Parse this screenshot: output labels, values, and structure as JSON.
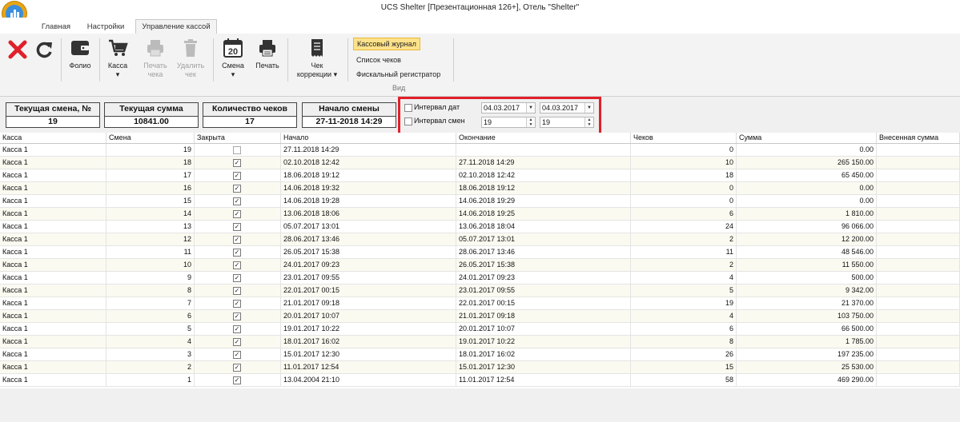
{
  "window": {
    "title": "UCS Shelter [Презентационная 126+], Отель \"Shelter\""
  },
  "tabs": [
    {
      "label": "Главная",
      "active": false
    },
    {
      "label": "Настройки",
      "active": false
    },
    {
      "label": "Управление кассой",
      "active": true
    }
  ],
  "ribbon": {
    "folio": "Фолио",
    "kassa": "Касса",
    "print_check": "Печать\nчека",
    "delete_check": "Удалить\nчек",
    "calendar_day": "20",
    "shift": "Смена",
    "print": "Печать",
    "correction": "Чек\nкоррекции",
    "view_items": [
      "Кассовый журнал",
      "Список чеков",
      "Фискальный регистратор"
    ],
    "view_group_label": "Вид"
  },
  "info": {
    "shift_title": "Текущая смена, №",
    "shift_value": "19",
    "sum_title": "Текущая сумма",
    "sum_value": "10841.00",
    "count_title": "Количество чеков",
    "count_value": "17",
    "start_title": "Начало смены",
    "start_value": "27-11-2018 14:29"
  },
  "filter": {
    "date_label": "Интервал дат",
    "shift_label": "Интервал смен",
    "date_from": "04.03.2017",
    "date_to": "04.03.2017",
    "shift_from": "19",
    "shift_to": "19"
  },
  "table": {
    "columns": [
      "Касса",
      "Смена",
      "Закрыта",
      "Начало",
      "Окончание",
      "Чеков",
      "Сумма",
      "Внесенная сумма"
    ],
    "rows": [
      {
        "kassa": "Касса 1",
        "shift": "19",
        "closed": false,
        "start": "27.11.2018 14:29",
        "end": "",
        "checks": "0",
        "sum": "0.00"
      },
      {
        "kassa": "Касса 1",
        "shift": "18",
        "closed": true,
        "start": "02.10.2018 12:42",
        "end": "27.11.2018 14:29",
        "checks": "10",
        "sum": "265 150.00"
      },
      {
        "kassa": "Касса 1",
        "shift": "17",
        "closed": true,
        "start": "18.06.2018 19:12",
        "end": "02.10.2018 12:42",
        "checks": "18",
        "sum": "65 450.00"
      },
      {
        "kassa": "Касса 1",
        "shift": "16",
        "closed": true,
        "start": "14.06.2018 19:32",
        "end": "18.06.2018 19:12",
        "checks": "0",
        "sum": "0.00"
      },
      {
        "kassa": "Касса 1",
        "shift": "15",
        "closed": true,
        "start": "14.06.2018 19:28",
        "end": "14.06.2018 19:29",
        "checks": "0",
        "sum": "0.00"
      },
      {
        "kassa": "Касса 1",
        "shift": "14",
        "closed": true,
        "start": "13.06.2018 18:06",
        "end": "14.06.2018 19:25",
        "checks": "6",
        "sum": "1 810.00"
      },
      {
        "kassa": "Касса 1",
        "shift": "13",
        "closed": true,
        "start": "05.07.2017 13:01",
        "end": "13.06.2018 18:04",
        "checks": "24",
        "sum": "96 066.00"
      },
      {
        "kassa": "Касса 1",
        "shift": "12",
        "closed": true,
        "start": "28.06.2017 13:46",
        "end": "05.07.2017 13:01",
        "checks": "2",
        "sum": "12 200.00"
      },
      {
        "kassa": "Касса 1",
        "shift": "11",
        "closed": true,
        "start": "26.05.2017 15:38",
        "end": "28.06.2017 13:46",
        "checks": "11",
        "sum": "48 546.00"
      },
      {
        "kassa": "Касса 1",
        "shift": "10",
        "closed": true,
        "start": "24.01.2017 09:23",
        "end": "26.05.2017 15:38",
        "checks": "2",
        "sum": "11 550.00"
      },
      {
        "kassa": "Касса 1",
        "shift": "9",
        "closed": true,
        "start": "23.01.2017 09:55",
        "end": "24.01.2017 09:23",
        "checks": "4",
        "sum": "500.00"
      },
      {
        "kassa": "Касса 1",
        "shift": "8",
        "closed": true,
        "start": "22.01.2017 00:15",
        "end": "23.01.2017 09:55",
        "checks": "5",
        "sum": "9 342.00"
      },
      {
        "kassa": "Касса 1",
        "shift": "7",
        "closed": true,
        "start": "21.01.2017 09:18",
        "end": "22.01.2017 00:15",
        "checks": "19",
        "sum": "21 370.00"
      },
      {
        "kassa": "Касса 1",
        "shift": "6",
        "closed": true,
        "start": "20.01.2017 10:07",
        "end": "21.01.2017 09:18",
        "checks": "4",
        "sum": "103 750.00"
      },
      {
        "kassa": "Касса 1",
        "shift": "5",
        "closed": true,
        "start": "19.01.2017 10:22",
        "end": "20.01.2017 10:07",
        "checks": "6",
        "sum": "66 500.00"
      },
      {
        "kassa": "Касса 1",
        "shift": "4",
        "closed": true,
        "start": "18.01.2017 16:02",
        "end": "19.01.2017 10:22",
        "checks": "8",
        "sum": "1 785.00"
      },
      {
        "kassa": "Касса 1",
        "shift": "3",
        "closed": true,
        "start": "15.01.2017 12:30",
        "end": "18.01.2017 16:02",
        "checks": "26",
        "sum": "197 235.00"
      },
      {
        "kassa": "Касса 1",
        "shift": "2",
        "closed": true,
        "start": "11.01.2017 12:54",
        "end": "15.01.2017 12:30",
        "checks": "15",
        "sum": "25 530.00"
      },
      {
        "kassa": "Касса 1",
        "shift": "1",
        "closed": true,
        "start": "13.04.2004 21:10",
        "end": "11.01.2017 12:54",
        "checks": "58",
        "sum": "469 290.00"
      }
    ]
  },
  "colors": {
    "accent_red": "#e0202a",
    "selected_view": "#fde28a",
    "logo_orange": "#e8a515",
    "logo_blue": "#3a8ede"
  }
}
